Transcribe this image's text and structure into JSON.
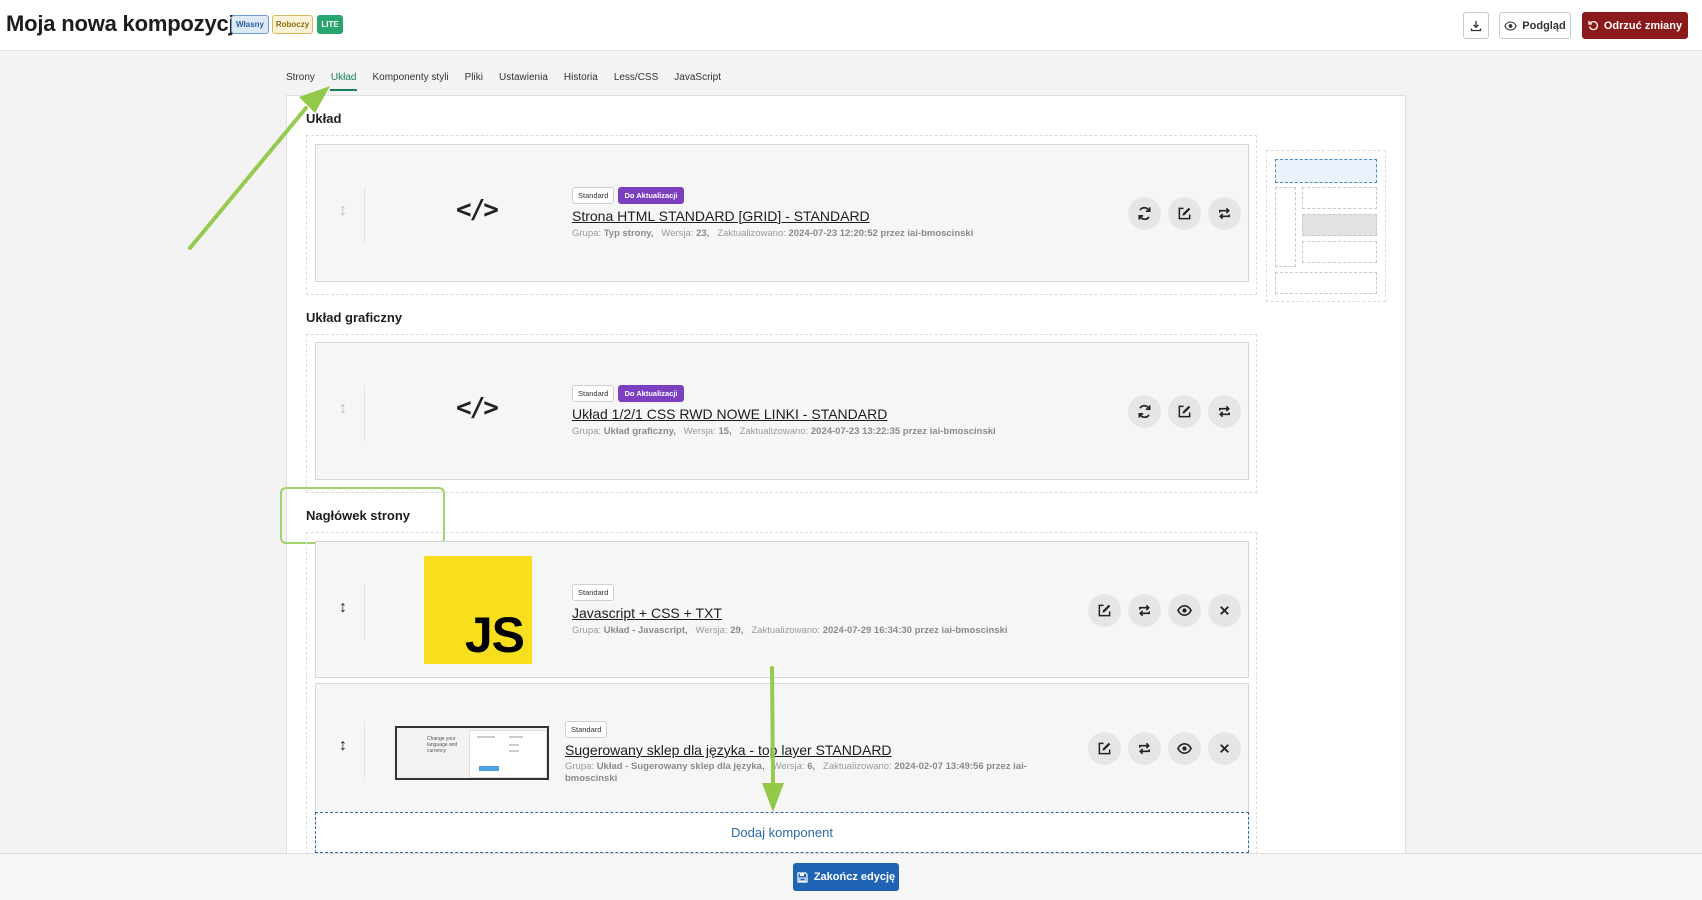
{
  "header": {
    "title": "Moja nowa kompozycja",
    "badges": [
      "Własny",
      "Roboczy",
      "LITE"
    ],
    "preview_label": "Podgląd",
    "discard_label": "Odrzuć zmiany"
  },
  "tabs": [
    {
      "label": "Strony",
      "active": false
    },
    {
      "label": "Układ",
      "active": true
    },
    {
      "label": "Komponenty styli",
      "active": false
    },
    {
      "label": "Pliki",
      "active": false
    },
    {
      "label": "Ustawienia",
      "active": false
    },
    {
      "label": "Historia",
      "active": false
    },
    {
      "label": "Less/CSS",
      "active": false
    },
    {
      "label": "JavaScript",
      "active": false
    }
  ],
  "sections": [
    {
      "title": "Układ",
      "components": [
        {
          "tags": [
            "Standard",
            "Do Aktualizacji"
          ],
          "name": "Strona HTML STANDARD [GRID] - STANDARD",
          "meta_group_label": "Grupa:",
          "meta_group": "Typ strony,",
          "meta_version_label": "Wersja:",
          "meta_version": "23,",
          "meta_updated_label": "Zaktualizowano:",
          "meta_updated": "2024-07-23 12:20:52 przez iai-bmoscinski"
        }
      ]
    },
    {
      "title": "Układ graficzny",
      "components": [
        {
          "tags": [
            "Standard",
            "Do Aktualizacji"
          ],
          "name": "Układ 1/2/1 CSS RWD NOWE LINKI - STANDARD",
          "meta_group_label": "Grupa:",
          "meta_group": "Układ graficzny,",
          "meta_version_label": "Wersja:",
          "meta_version": "15,",
          "meta_updated_label": "Zaktualizowano:",
          "meta_updated": "2024-07-23 13:22:35 przez iai-bmoscinski"
        }
      ]
    },
    {
      "title": "Nagłówek strony",
      "components": [
        {
          "tags": [
            "Standard"
          ],
          "name": "Javascript + CSS + TXT",
          "thumb_text": "JS",
          "meta_group_label": "Grupa:",
          "meta_group": "Układ - Javascript,",
          "meta_version_label": "Wersja:",
          "meta_version": "29,",
          "meta_updated_label": "Zaktualizowano:",
          "meta_updated": "2024-07-29 16:34:30 przez iai-bmoscinski"
        },
        {
          "tags": [
            "Standard"
          ],
          "name": "Sugerowany sklep dla języka - top layer STANDARD",
          "thumb_text": "Change your language and currency",
          "meta_group_label": "Grupa:",
          "meta_group": "Układ - Sugerowany sklep dla języka,",
          "meta_version_label": "Wersja:",
          "meta_version": "6,",
          "meta_updated_label": "Zaktualizowano:",
          "meta_updated": "2024-02-07 13:49:56 przez iai-bmoscinski"
        }
      ],
      "add_label": "Dodaj komponent"
    }
  ],
  "footer": {
    "finish_label": "Zakończ edycję"
  },
  "colors": {
    "accent_green": "#1a7f5a",
    "discard_red": "#8b1a1a",
    "finish_blue": "#1f63b4",
    "tag_purple": "#7b3fc0",
    "annotation_green": "#8cc63f"
  }
}
